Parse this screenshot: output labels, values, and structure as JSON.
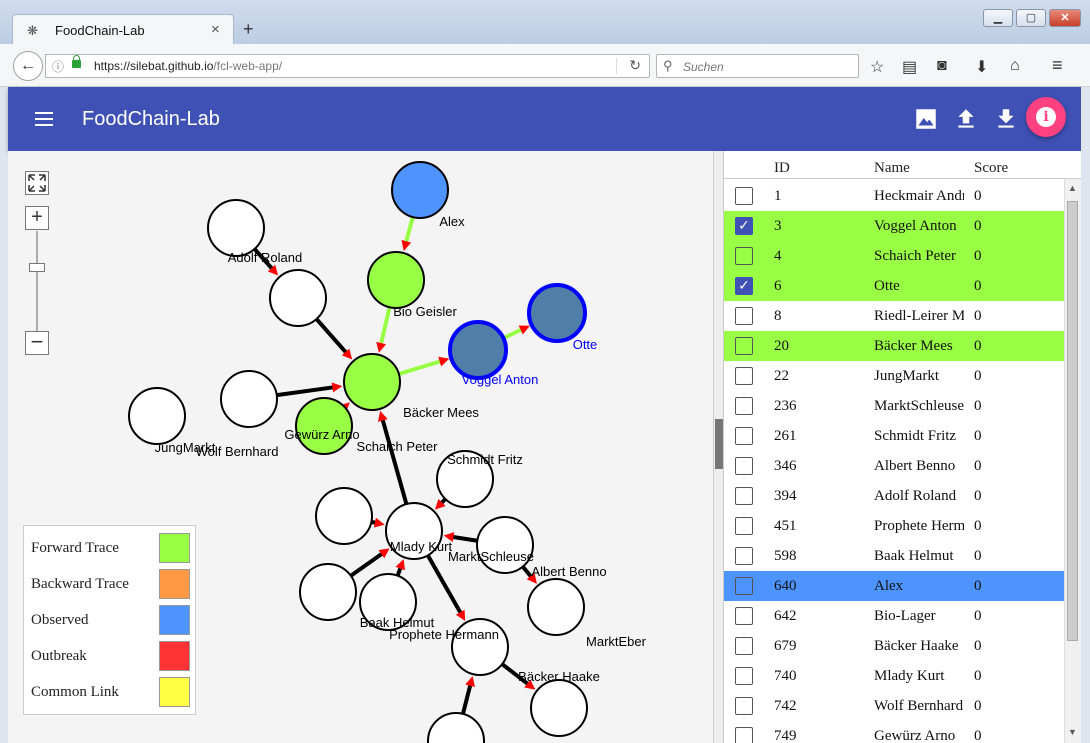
{
  "browser": {
    "tab_title": "FoodChain-Lab",
    "url_host": "https://silebat.github.io",
    "url_path": "/fcl-web-app/",
    "search_placeholder": "Suchen"
  },
  "app": {
    "title": "FoodChain-Lab"
  },
  "graph": {
    "nodes": [
      {
        "id": "n1",
        "label": "Alex",
        "fill": "#4d94ff",
        "stroke": "#000",
        "label_color": "#000"
      },
      {
        "id": "n2",
        "label": "",
        "fill": "#99ff44",
        "stroke": "#000",
        "label_color": "#000"
      },
      {
        "id": "n3",
        "label": "Adolf Roland",
        "fill": "#ffffff",
        "stroke": "#000",
        "label_color": "#000"
      },
      {
        "id": "n4",
        "label": "",
        "fill": "#ffffff",
        "stroke": "#000",
        "label_color": "#000"
      },
      {
        "id": "n5",
        "label": "JungMarkt",
        "fill": "#ffffff",
        "stroke": "#000",
        "label_color": "#000"
      },
      {
        "id": "n6",
        "label": "Bio Geisler",
        "fill": "#99ff44",
        "stroke": "#000",
        "label_color": "#000"
      },
      {
        "id": "n7",
        "label": "Voggel Anton",
        "fill": "#4f7fa8",
        "stroke": "#0000ff",
        "label_color": "#0000ff"
      },
      {
        "id": "n8",
        "label": "Otte",
        "fill": "#4f7fa8",
        "stroke": "#0000ff",
        "label_color": "#0000ff"
      },
      {
        "id": "n9",
        "label": "Bäcker Mees",
        "fill": "#99ff44",
        "stroke": "#000",
        "label_color": "#000"
      },
      {
        "id": "n10",
        "label": "Gewürz Arno",
        "fill": "#ffffff",
        "stroke": "#000",
        "label_color": "#000"
      },
      {
        "id": "n11",
        "label": "Wolf Bernhard",
        "fill": "#ffffff",
        "stroke": "#000",
        "label_color": "#000"
      },
      {
        "id": "n12",
        "label": "Schaich Peter",
        "fill": "#ffffff",
        "stroke": "#000",
        "label_color": "#000"
      },
      {
        "id": "n13",
        "label": "Schmidt Fritz",
        "fill": "#ffffff",
        "stroke": "#000",
        "label_color": "#000"
      },
      {
        "id": "n14",
        "label": "",
        "fill": "#ffffff",
        "stroke": "#000",
        "label_color": "#000"
      },
      {
        "id": "n15",
        "label": "Mlady Kurt",
        "fill": "#ffffff",
        "stroke": "#000",
        "label_color": "#000"
      },
      {
        "id": "n16",
        "label": "MarktSchleuse",
        "fill": "#ffffff",
        "stroke": "#000",
        "label_color": "#000"
      },
      {
        "id": "n17",
        "label": "",
        "fill": "#ffffff",
        "stroke": "#000",
        "label_color": "#000"
      },
      {
        "id": "n18",
        "label": "Baak Helmut",
        "fill": "#ffffff",
        "stroke": "#000",
        "label_color": "#000"
      },
      {
        "id": "n19",
        "label": "Albert Benno",
        "fill": "#ffffff",
        "stroke": "#000",
        "label_color": "#000"
      },
      {
        "id": "n20",
        "label": "Prophete Hermann",
        "fill": "#ffffff",
        "stroke": "#000",
        "label_color": "#000"
      },
      {
        "id": "n21",
        "label": "MarktEber",
        "fill": "#ffffff",
        "stroke": "#000",
        "label_color": "#000"
      },
      {
        "id": "n22",
        "label": "Bäcker Haake",
        "fill": "#ffffff",
        "stroke": "#000",
        "label_color": "#000"
      },
      {
        "id": "n23",
        "label": "",
        "fill": "#ffffff",
        "stroke": "#000",
        "label_color": "#000"
      }
    ],
    "edges": [
      {
        "from": "n1",
        "to": "n2",
        "color": "#99ff44"
      },
      {
        "from": "n2",
        "to": "n6",
        "color": "#99ff44"
      },
      {
        "from": "n3",
        "to": "n4",
        "color": "#000"
      },
      {
        "from": "n4",
        "to": "n6",
        "color": "#000"
      },
      {
        "from": "n6",
        "to": "n7",
        "color": "#99ff44"
      },
      {
        "from": "n7",
        "to": "n8",
        "color": "#99ff44"
      },
      {
        "from": "n5",
        "to": "n6",
        "color": "#000"
      },
      {
        "from": "n11",
        "to": "n5",
        "color": "#000"
      },
      {
        "from": "n9",
        "to": "n6",
        "color": "#000"
      },
      {
        "from": "n15",
        "to": "n6",
        "color": "#000"
      },
      {
        "from": "n14",
        "to": "n15",
        "color": "#000"
      },
      {
        "from": "n13",
        "to": "n15",
        "color": "#000"
      },
      {
        "from": "n16",
        "to": "n15",
        "color": "#000"
      },
      {
        "from": "n17",
        "to": "n15",
        "color": "#000"
      },
      {
        "from": "n18",
        "to": "n15",
        "color": "#000"
      },
      {
        "from": "n15",
        "to": "n20",
        "color": "#000"
      },
      {
        "from": "n16",
        "to": "n19",
        "color": "#000"
      },
      {
        "from": "n20",
        "to": "n22",
        "color": "#000"
      },
      {
        "from": "n23",
        "to": "n20",
        "color": "#000"
      }
    ]
  },
  "legend": [
    {
      "label": "Forward Trace",
      "color": "#99ff44"
    },
    {
      "label": "Backward Trace",
      "color": "#ff9944"
    },
    {
      "label": "Observed",
      "color": "#4d94ff"
    },
    {
      "label": "Outbreak",
      "color": "#ff3333"
    },
    {
      "label": "Common Link",
      "color": "#ffff44"
    }
  ],
  "table": {
    "columns": [
      "ID",
      "Name",
      "Score"
    ],
    "rows": [
      {
        "id": "1",
        "name": "Heckmair Andreas",
        "score": "0",
        "checked": false,
        "highlight": ""
      },
      {
        "id": "3",
        "name": "Voggel Anton",
        "score": "0",
        "checked": true,
        "highlight": "forward"
      },
      {
        "id": "4",
        "name": "Schaich Peter",
        "score": "0",
        "checked": false,
        "highlight": "forward"
      },
      {
        "id": "6",
        "name": "Otte",
        "score": "0",
        "checked": true,
        "highlight": "forward"
      },
      {
        "id": "8",
        "name": "Riedl-Leirer M",
        "score": "0",
        "checked": false,
        "highlight": ""
      },
      {
        "id": "20",
        "name": "Bäcker Mees",
        "score": "0",
        "checked": false,
        "highlight": "forward"
      },
      {
        "id": "22",
        "name": "JungMarkt",
        "score": "0",
        "checked": false,
        "highlight": ""
      },
      {
        "id": "236",
        "name": "MarktSchleuse",
        "score": "0",
        "checked": false,
        "highlight": ""
      },
      {
        "id": "261",
        "name": "Schmidt Fritz",
        "score": "0",
        "checked": false,
        "highlight": ""
      },
      {
        "id": "346",
        "name": "Albert Benno",
        "score": "0",
        "checked": false,
        "highlight": ""
      },
      {
        "id": "394",
        "name": "Adolf Roland",
        "score": "0",
        "checked": false,
        "highlight": ""
      },
      {
        "id": "451",
        "name": "Prophete Hermann",
        "score": "0",
        "checked": false,
        "highlight": ""
      },
      {
        "id": "598",
        "name": "Baak Helmut",
        "score": "0",
        "checked": false,
        "highlight": ""
      },
      {
        "id": "640",
        "name": "Alex",
        "score": "0",
        "checked": false,
        "highlight": "observed"
      },
      {
        "id": "642",
        "name": "Bio-Lager",
        "score": "0",
        "checked": false,
        "highlight": ""
      },
      {
        "id": "679",
        "name": "Bäcker Haake",
        "score": "0",
        "checked": false,
        "highlight": ""
      },
      {
        "id": "740",
        "name": "Mlady Kurt",
        "score": "0",
        "checked": false,
        "highlight": ""
      },
      {
        "id": "742",
        "name": "Wolf Bernhard",
        "score": "0",
        "checked": false,
        "highlight": ""
      },
      {
        "id": "749",
        "name": "Gewürz Arno",
        "score": "0",
        "checked": false,
        "highlight": ""
      }
    ]
  }
}
